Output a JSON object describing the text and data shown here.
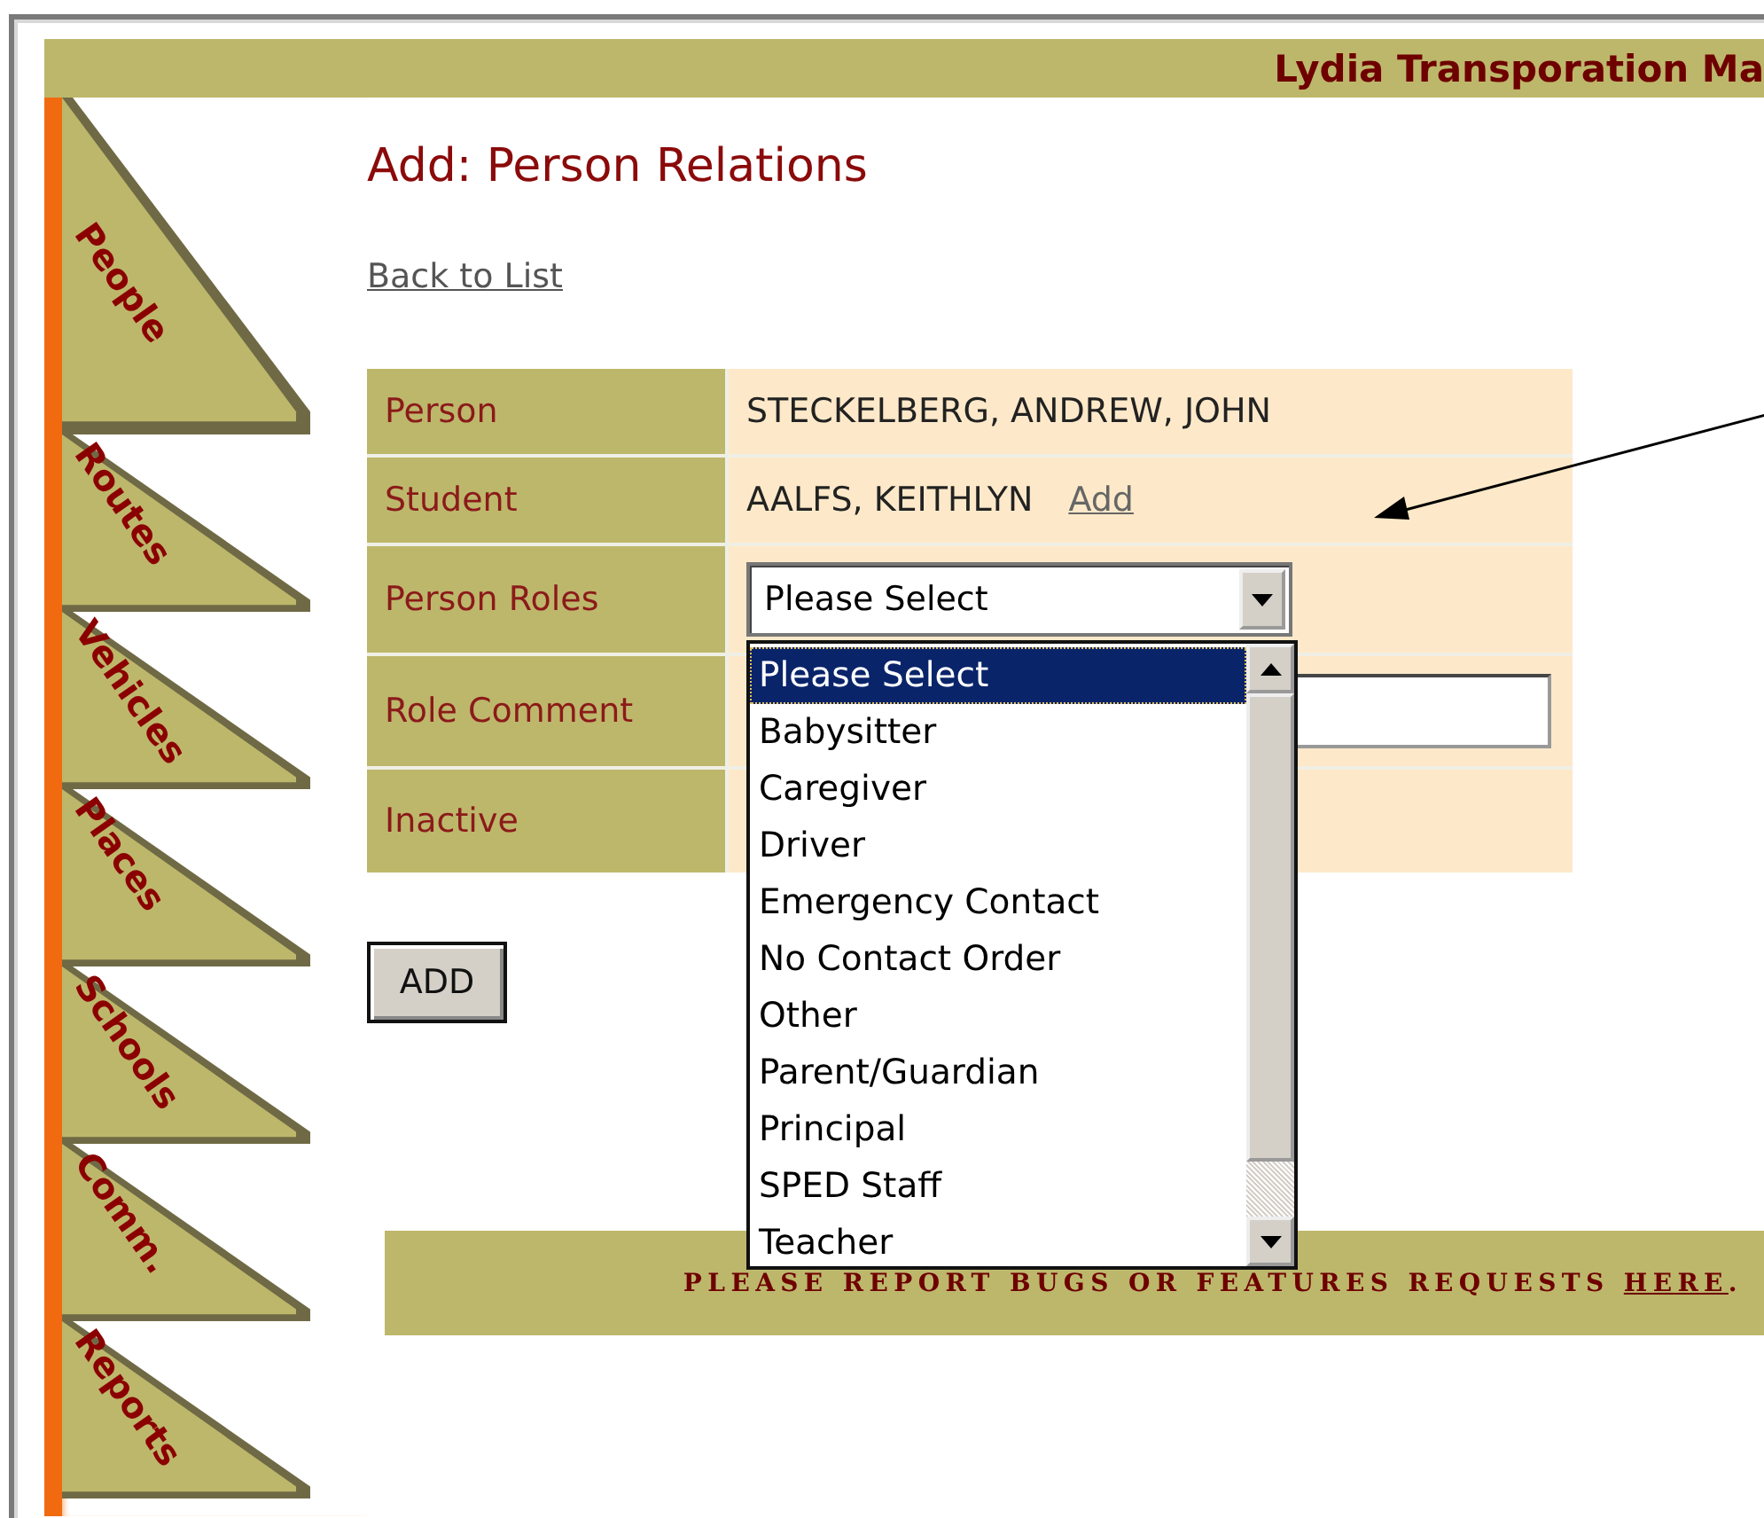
{
  "header": {
    "title": "Lydia Transporation Ma"
  },
  "nav_tabs": [
    {
      "label": "People"
    },
    {
      "label": "Routes"
    },
    {
      "label": "Vehicles"
    },
    {
      "label": "Places"
    },
    {
      "label": "Schools"
    },
    {
      "label": "Comm."
    },
    {
      "label": "Reports"
    }
  ],
  "page_title": "Add: Person Relations",
  "back_link": "Back to List",
  "form": {
    "rows": [
      {
        "kind": "text",
        "label": "Person",
        "value": "STECKELBERG, ANDREW, JOHN"
      },
      {
        "kind": "text_link",
        "label": "Student",
        "value": "AALFS, KEITHLYN",
        "link": "Add"
      },
      {
        "kind": "select",
        "label": "Person Roles",
        "value": "Please Select"
      },
      {
        "kind": "input",
        "label": "Role Comment"
      },
      {
        "kind": "blank",
        "label": "Inactive"
      }
    ]
  },
  "dropdown_list": {
    "options": [
      {
        "label": "Please Select",
        "selected": true
      },
      {
        "label": "Babysitter",
        "selected": false
      },
      {
        "label": "Caregiver",
        "selected": false
      },
      {
        "label": "Driver",
        "selected": false
      },
      {
        "label": "Emergency Contact",
        "selected": false
      },
      {
        "label": "No Contact Order",
        "selected": false
      },
      {
        "label": "Other",
        "selected": false
      },
      {
        "label": "Parent/Guardian",
        "selected": false
      },
      {
        "label": "Principal",
        "selected": false
      },
      {
        "label": "SPED Staff",
        "selected": false
      },
      {
        "label": "Teacher",
        "selected": false
      }
    ]
  },
  "add_button": "ADD",
  "footer": {
    "before": "PLEASE REPORT BUGS OR FEATURES REQUESTS",
    "link": "HERE",
    "after": "."
  }
}
